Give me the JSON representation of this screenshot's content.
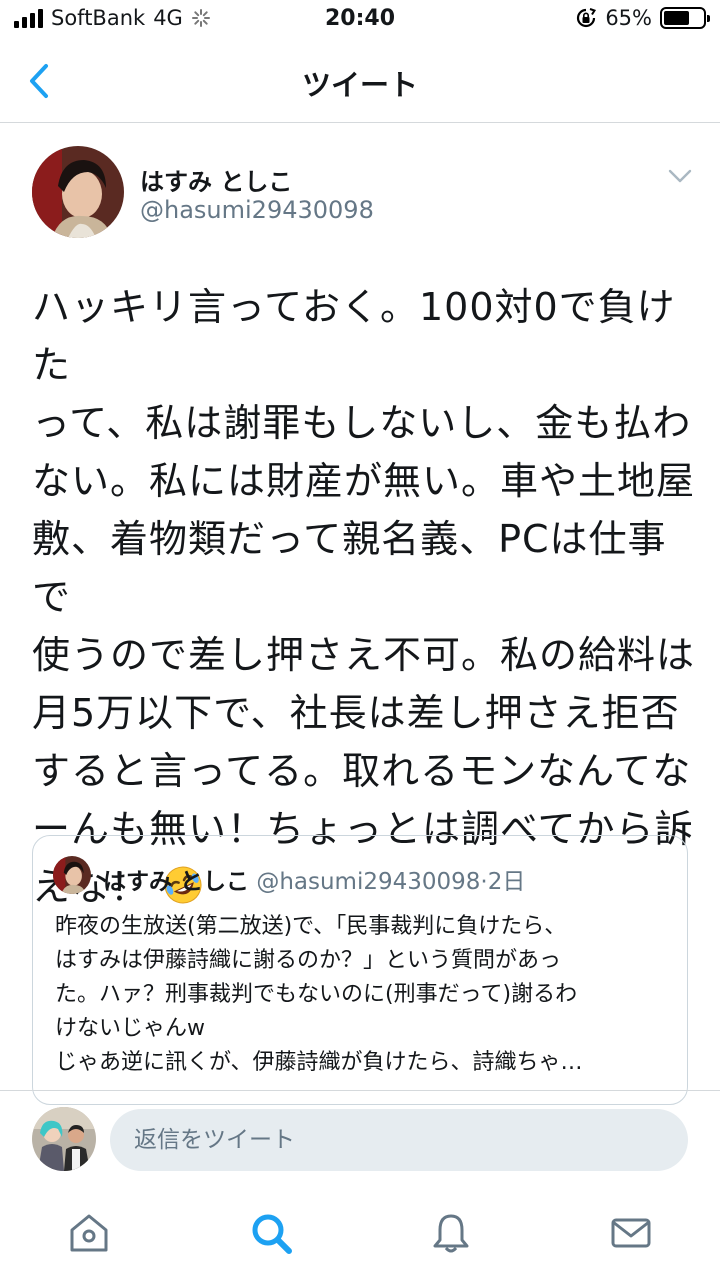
{
  "status_bar": {
    "carrier": "SoftBank",
    "network": "4G",
    "time": "20:40",
    "battery_percent": 65,
    "battery_label": "65%"
  },
  "nav": {
    "title": "ツイート"
  },
  "tweet": {
    "author_name": "はすみ としこ",
    "author_handle": "@hasumi29430098",
    "text": "ハッキリ言っておく。100対0で負けた\nって、私は謝罪もしないし、金も払わ\nない。私には財産が無い。車や土地屋\n敷、着物類だって親名義、PCは仕事で\n使うので差し押さえ不可。私の給料は\n月5万以下で、社長は差し押さえ拒否\nすると言ってる。取れるモンなんてな\nーんも無い！ちょっとは調べてから訴\nえな！",
    "emoji": "rolling-on-floor-laughing-icon"
  },
  "quoted_tweet": {
    "author_name": "はすみ としこ",
    "author_handle": "@hasumi29430098",
    "separator": "·",
    "time": "2日",
    "text": "昨夜の生放送(第二放送)で、「民事裁判に負けたら、\nはすみは伊藤詩織に謝るのか？」という質問があっ\nた。ハァ？刑事裁判でもないのに(刑事だって)謝るわ\nけないじゃんw\nじゃあ逆に訊くが、伊藤詩織が負けたら、詩織ちゃ…"
  },
  "reply": {
    "placeholder": "返信をツイート"
  },
  "tabs": [
    "home-icon",
    "search-icon",
    "notifications-icon",
    "messages-icon"
  ],
  "colors": {
    "accent": "#1da1f2",
    "secondary_text": "#657786",
    "divider": "#d5d9dc",
    "input_bg": "#e6ecf0"
  }
}
